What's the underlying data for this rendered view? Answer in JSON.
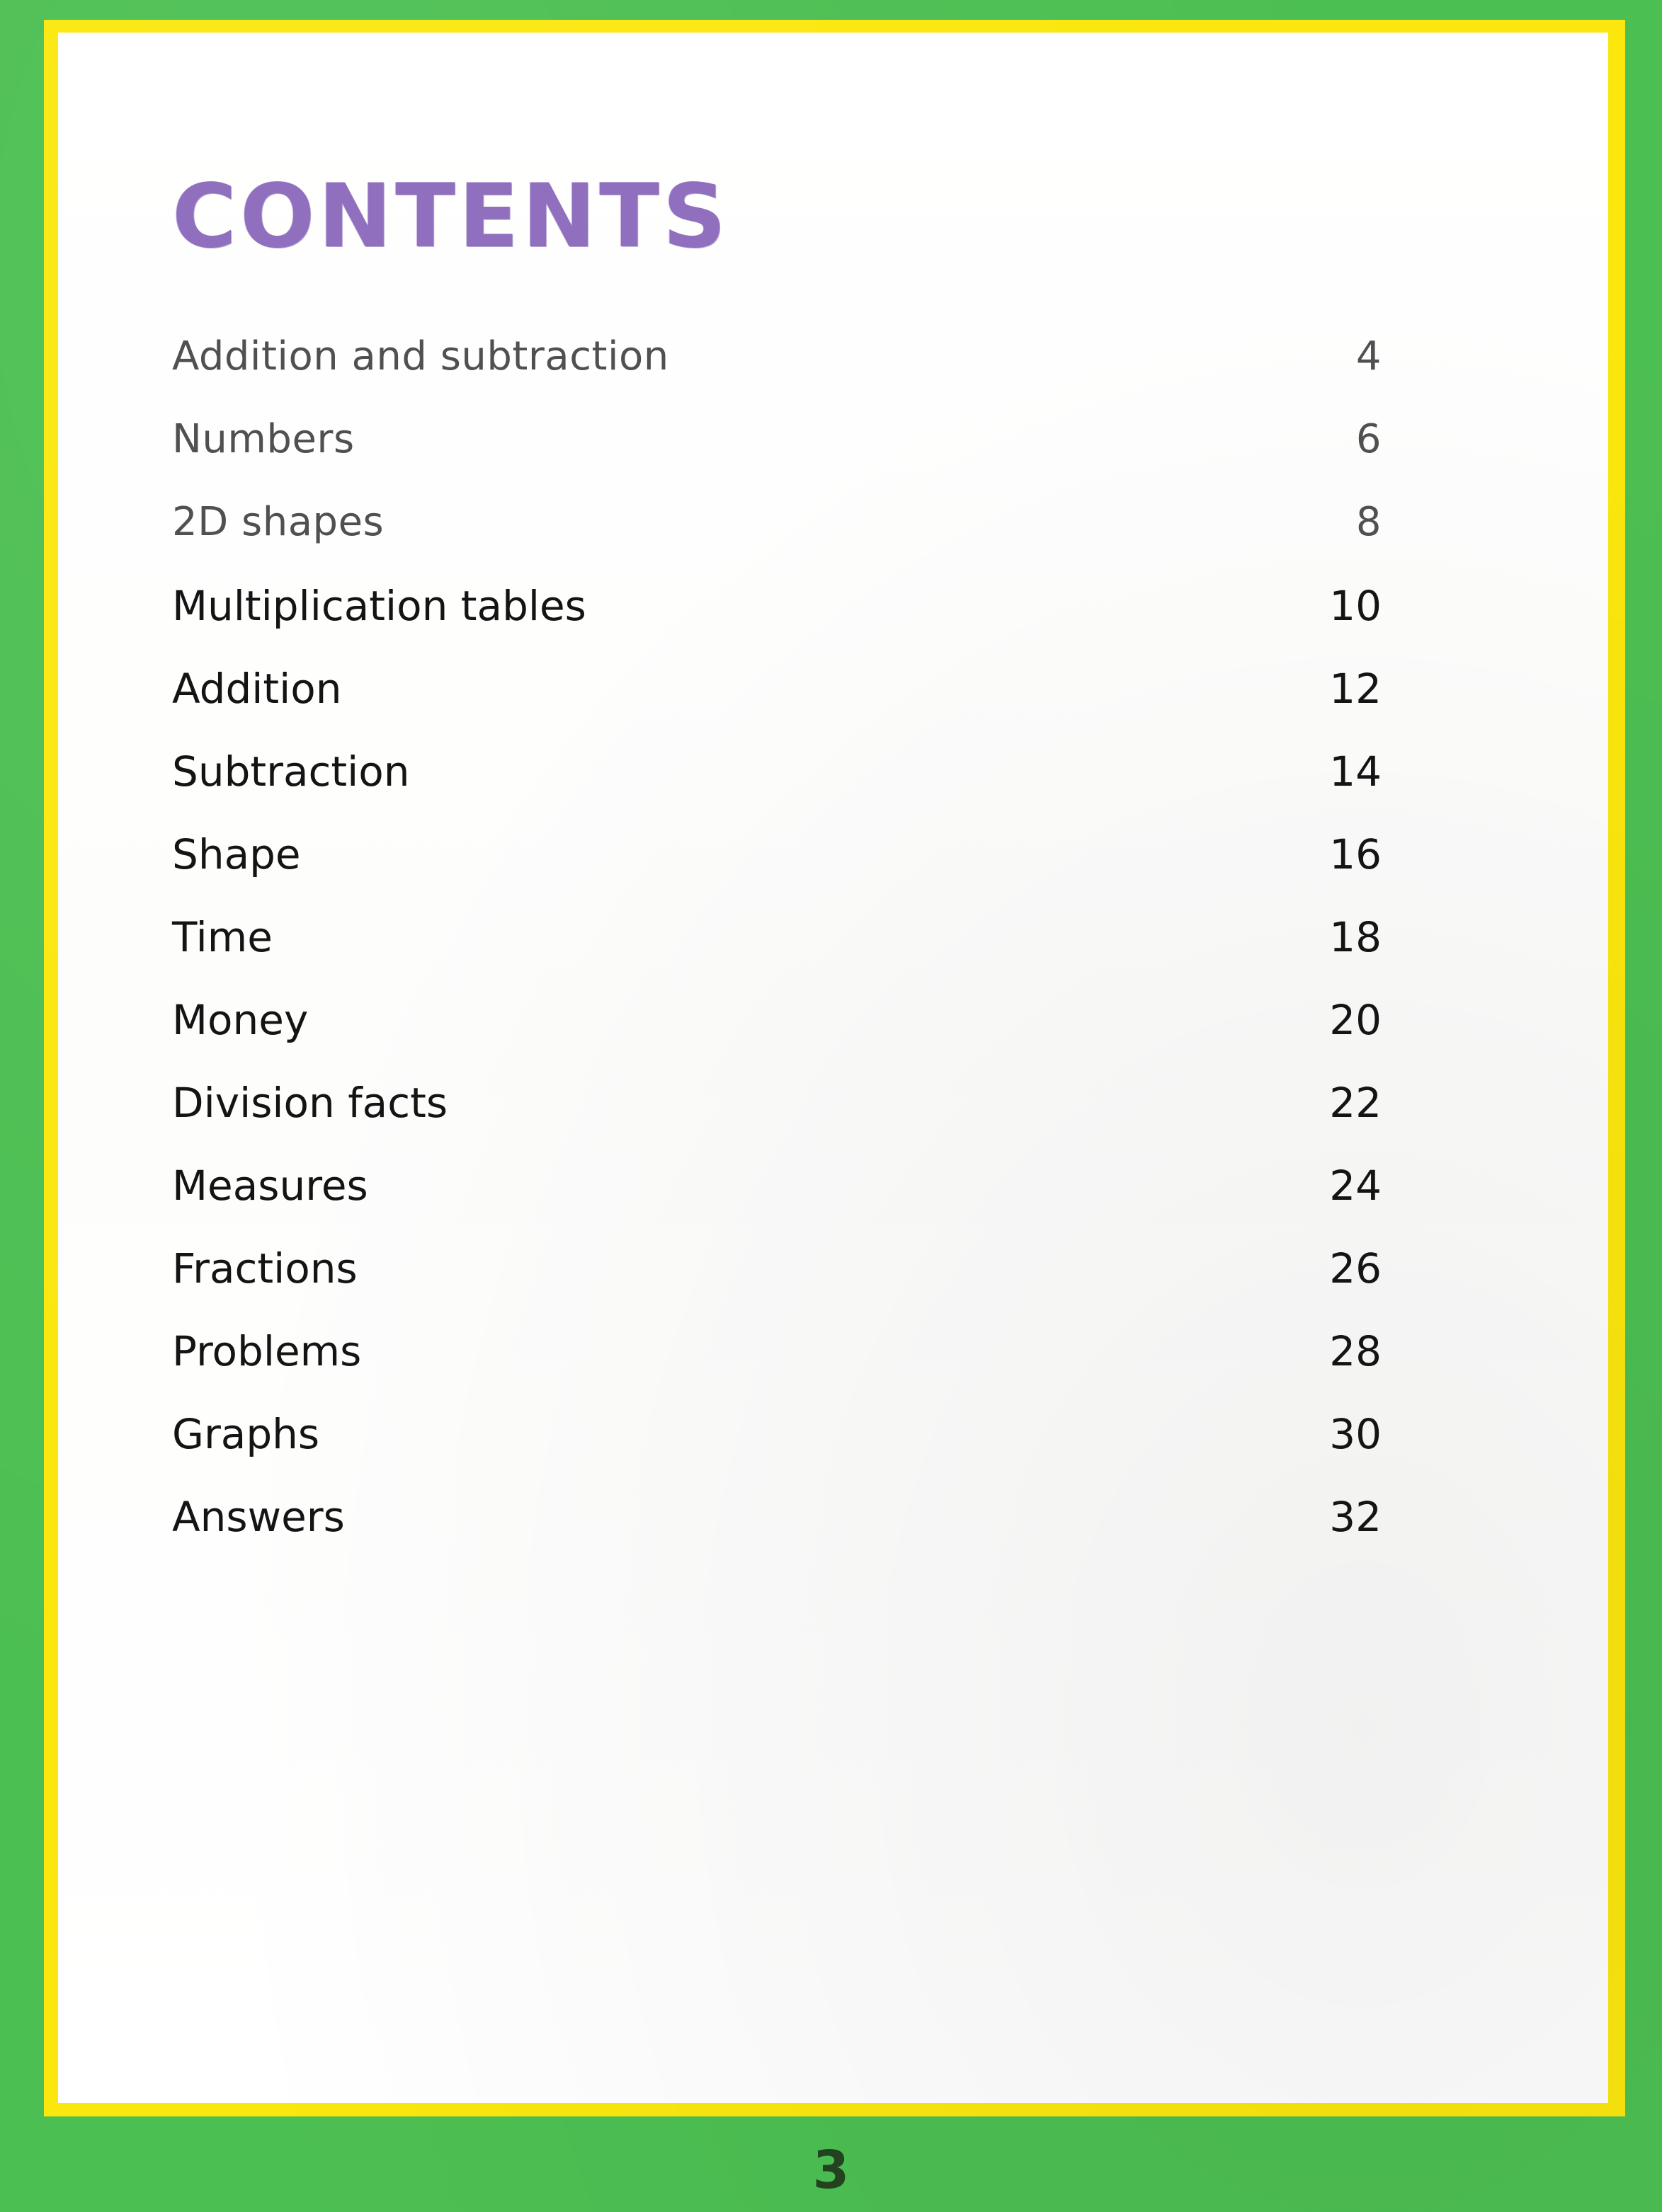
{
  "document": {
    "title": "CONTENTS",
    "page_label": "3"
  },
  "theme": {
    "border_green": "#4CBF52",
    "border_yellow": "#FBE70D",
    "page_background": "#FFFFFF",
    "title_purple": "#8F6FBE",
    "entry_text": "#141414",
    "page_number_color": "#23421F"
  },
  "contents": {
    "entries": [
      {
        "label": "Addition and subtraction",
        "page": "4"
      },
      {
        "label": "Numbers",
        "page": "6"
      },
      {
        "label": "2D shapes",
        "page": "8"
      },
      {
        "label": "Multiplication tables",
        "page": "10"
      },
      {
        "label": "Addition",
        "page": "12"
      },
      {
        "label": "Subtraction",
        "page": "14"
      },
      {
        "label": "Shape",
        "page": "16"
      },
      {
        "label": "Time",
        "page": "18"
      },
      {
        "label": "Money",
        "page": "20"
      },
      {
        "label": "Division facts",
        "page": "22"
      },
      {
        "label": "Measures",
        "page": "24"
      },
      {
        "label": "Fractions",
        "page": "26"
      },
      {
        "label": "Problems",
        "page": "28"
      },
      {
        "label": "Graphs",
        "page": "30"
      },
      {
        "label": "Answers",
        "page": "32"
      }
    ]
  }
}
